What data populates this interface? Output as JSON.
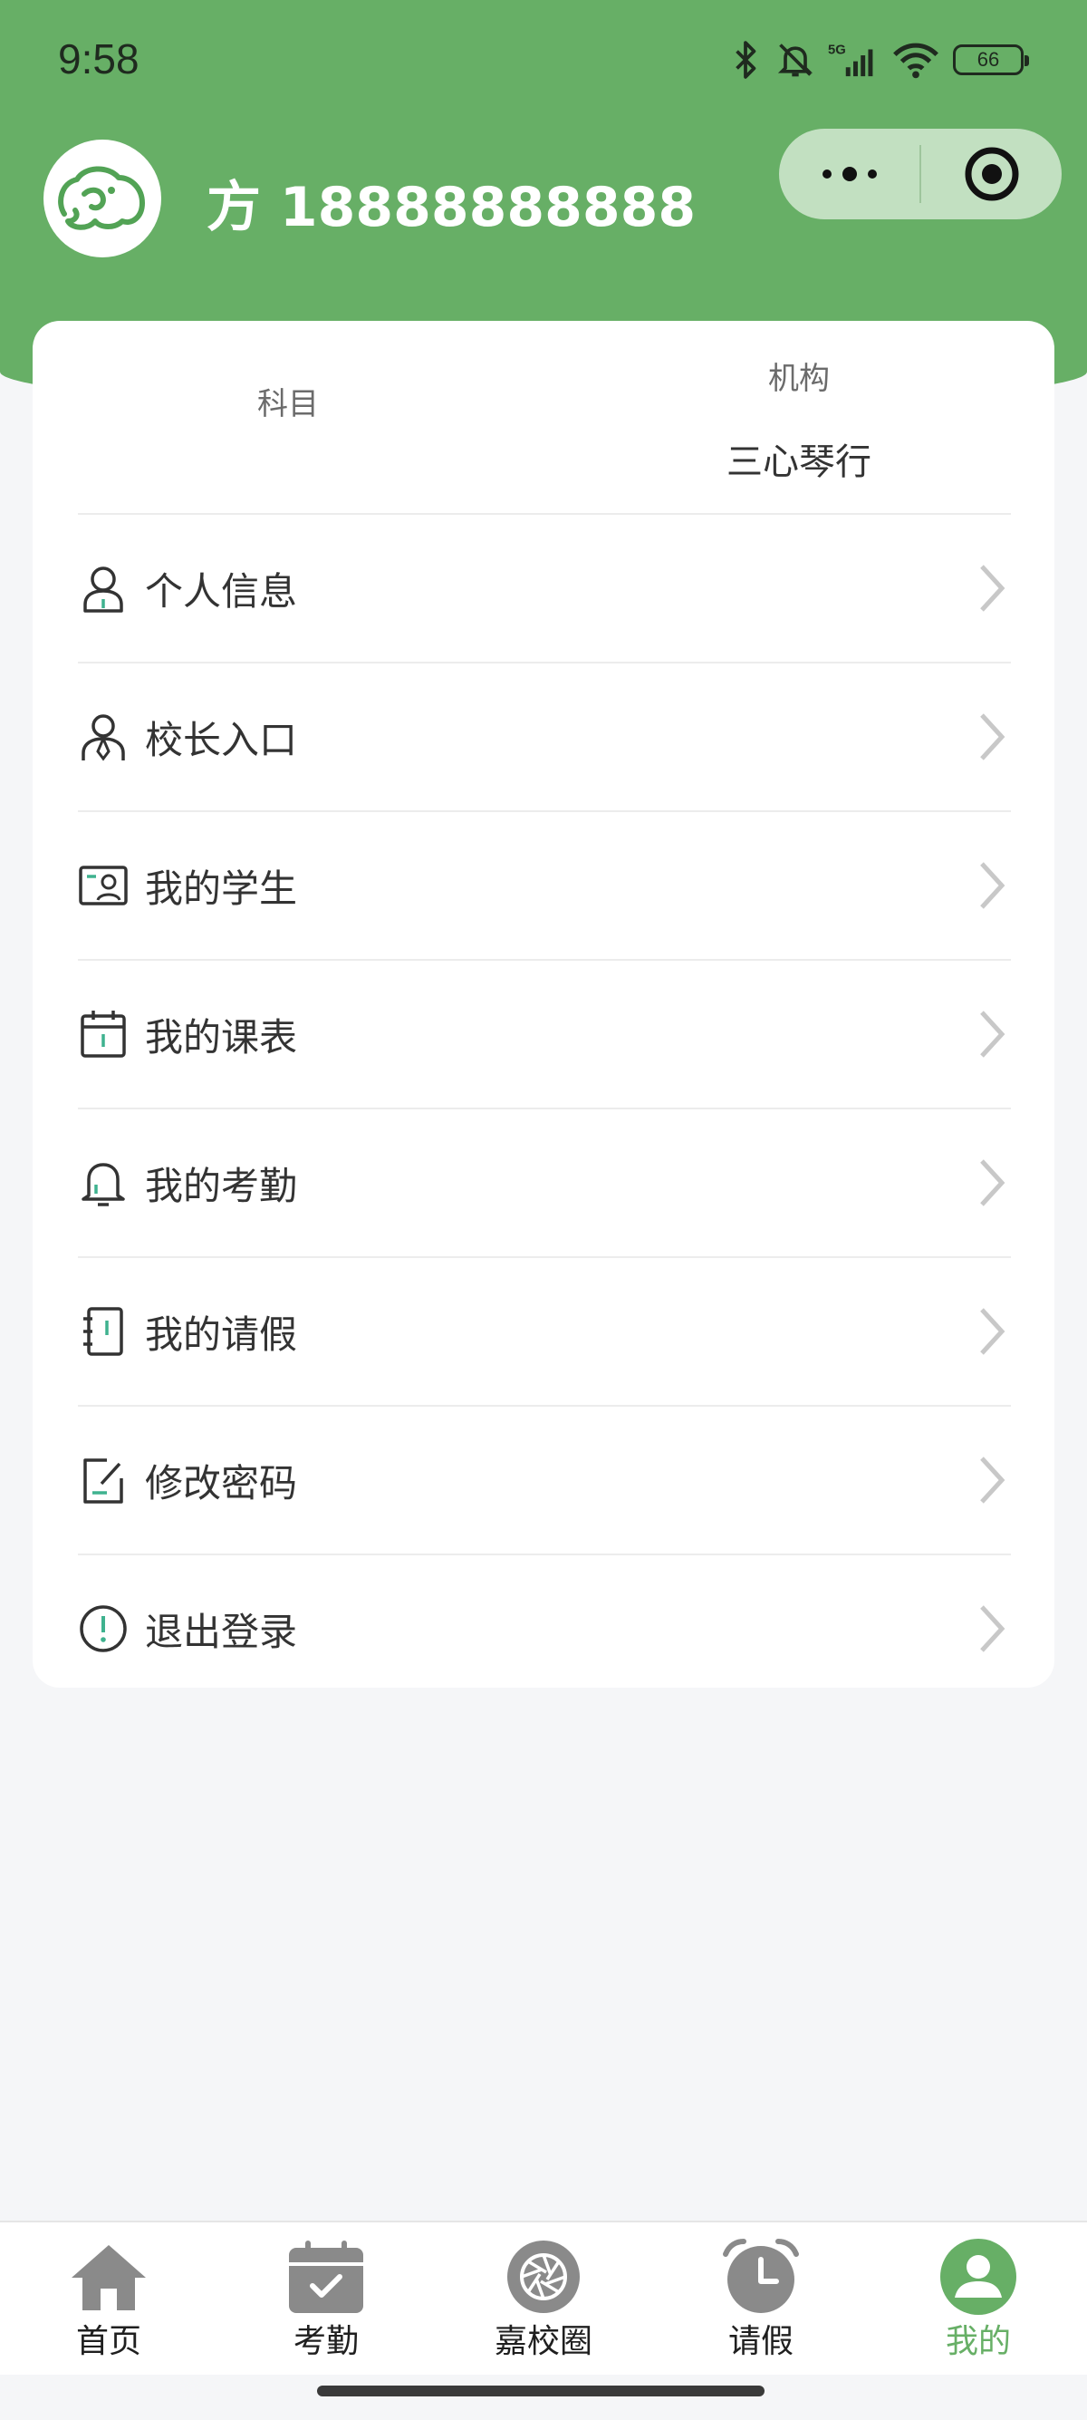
{
  "status_bar": {
    "time": "9:58",
    "battery": "66",
    "icons": [
      "bluetooth-icon",
      "bell-off-icon",
      "5g-signal-icon",
      "wifi-icon",
      "battery-icon"
    ]
  },
  "header": {
    "user_name": "方 18888888888",
    "capsule": {
      "more_icon": "more-dots-icon",
      "close_icon": "target-circle-icon"
    }
  },
  "profile": {
    "subject_label": "科目",
    "subject_value": "",
    "org_label": "机构",
    "org_value": "三心琴行"
  },
  "menu": {
    "items": [
      {
        "label": "个人信息",
        "icon": "person-icon"
      },
      {
        "label": "校长入口",
        "icon": "principal-icon"
      },
      {
        "label": "我的学生",
        "icon": "id-card-icon"
      },
      {
        "label": "我的课表",
        "icon": "calendar-icon"
      },
      {
        "label": "我的考勤",
        "icon": "bell-icon"
      },
      {
        "label": "我的请假",
        "icon": "notebook-icon"
      },
      {
        "label": "修改密码",
        "icon": "edit-icon"
      },
      {
        "label": "退出登录",
        "icon": "alert-circle-icon"
      }
    ]
  },
  "tabbar": {
    "tabs": [
      {
        "label": "首页",
        "icon": "home-icon",
        "active": false
      },
      {
        "label": "考勤",
        "icon": "calendar-check-icon",
        "active": false
      },
      {
        "label": "嘉校圈",
        "icon": "aperture-icon",
        "active": false
      },
      {
        "label": "请假",
        "icon": "alarm-clock-icon",
        "active": false
      },
      {
        "label": "我的",
        "icon": "user-circle-icon",
        "active": true
      }
    ]
  },
  "colors": {
    "brand_green": "#67af66",
    "capsule_bg": "#c2e0c1",
    "inactive_tab_icon": "#8a8a8a",
    "accent_teal": "#3fb28f"
  }
}
